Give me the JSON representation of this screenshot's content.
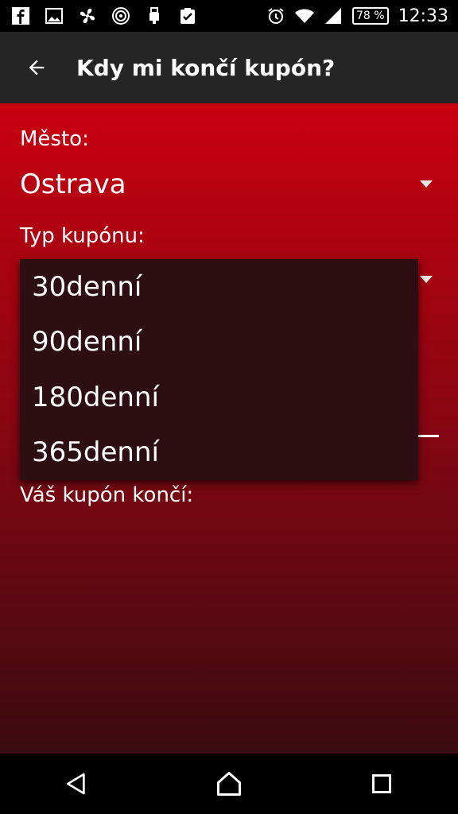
{
  "status_bar": {
    "left_icons": [
      "facebook-icon",
      "image-icon",
      "fan-icon",
      "target-icon",
      "usb-icon",
      "clipboard-check-icon"
    ],
    "right_icons": [
      "alarm-icon",
      "wifi-icon",
      "signal-icon"
    ],
    "battery": "78 %",
    "time": "12:33"
  },
  "toolbar": {
    "title": "Kdy mi končí kupón?"
  },
  "form": {
    "city_label": "Město:",
    "city_value": "Ostrava",
    "coupon_type_label": "Typ kupónu:",
    "result_label": "Váš kupón končí:"
  },
  "dropdown": {
    "options": [
      "30denní",
      "90denní",
      "180denní",
      "365denní"
    ]
  },
  "colors": {
    "toolbar": "#252525",
    "content_top": "#c90010",
    "content_bottom": "#3a0b10",
    "dropdown": "#2c0e13"
  }
}
